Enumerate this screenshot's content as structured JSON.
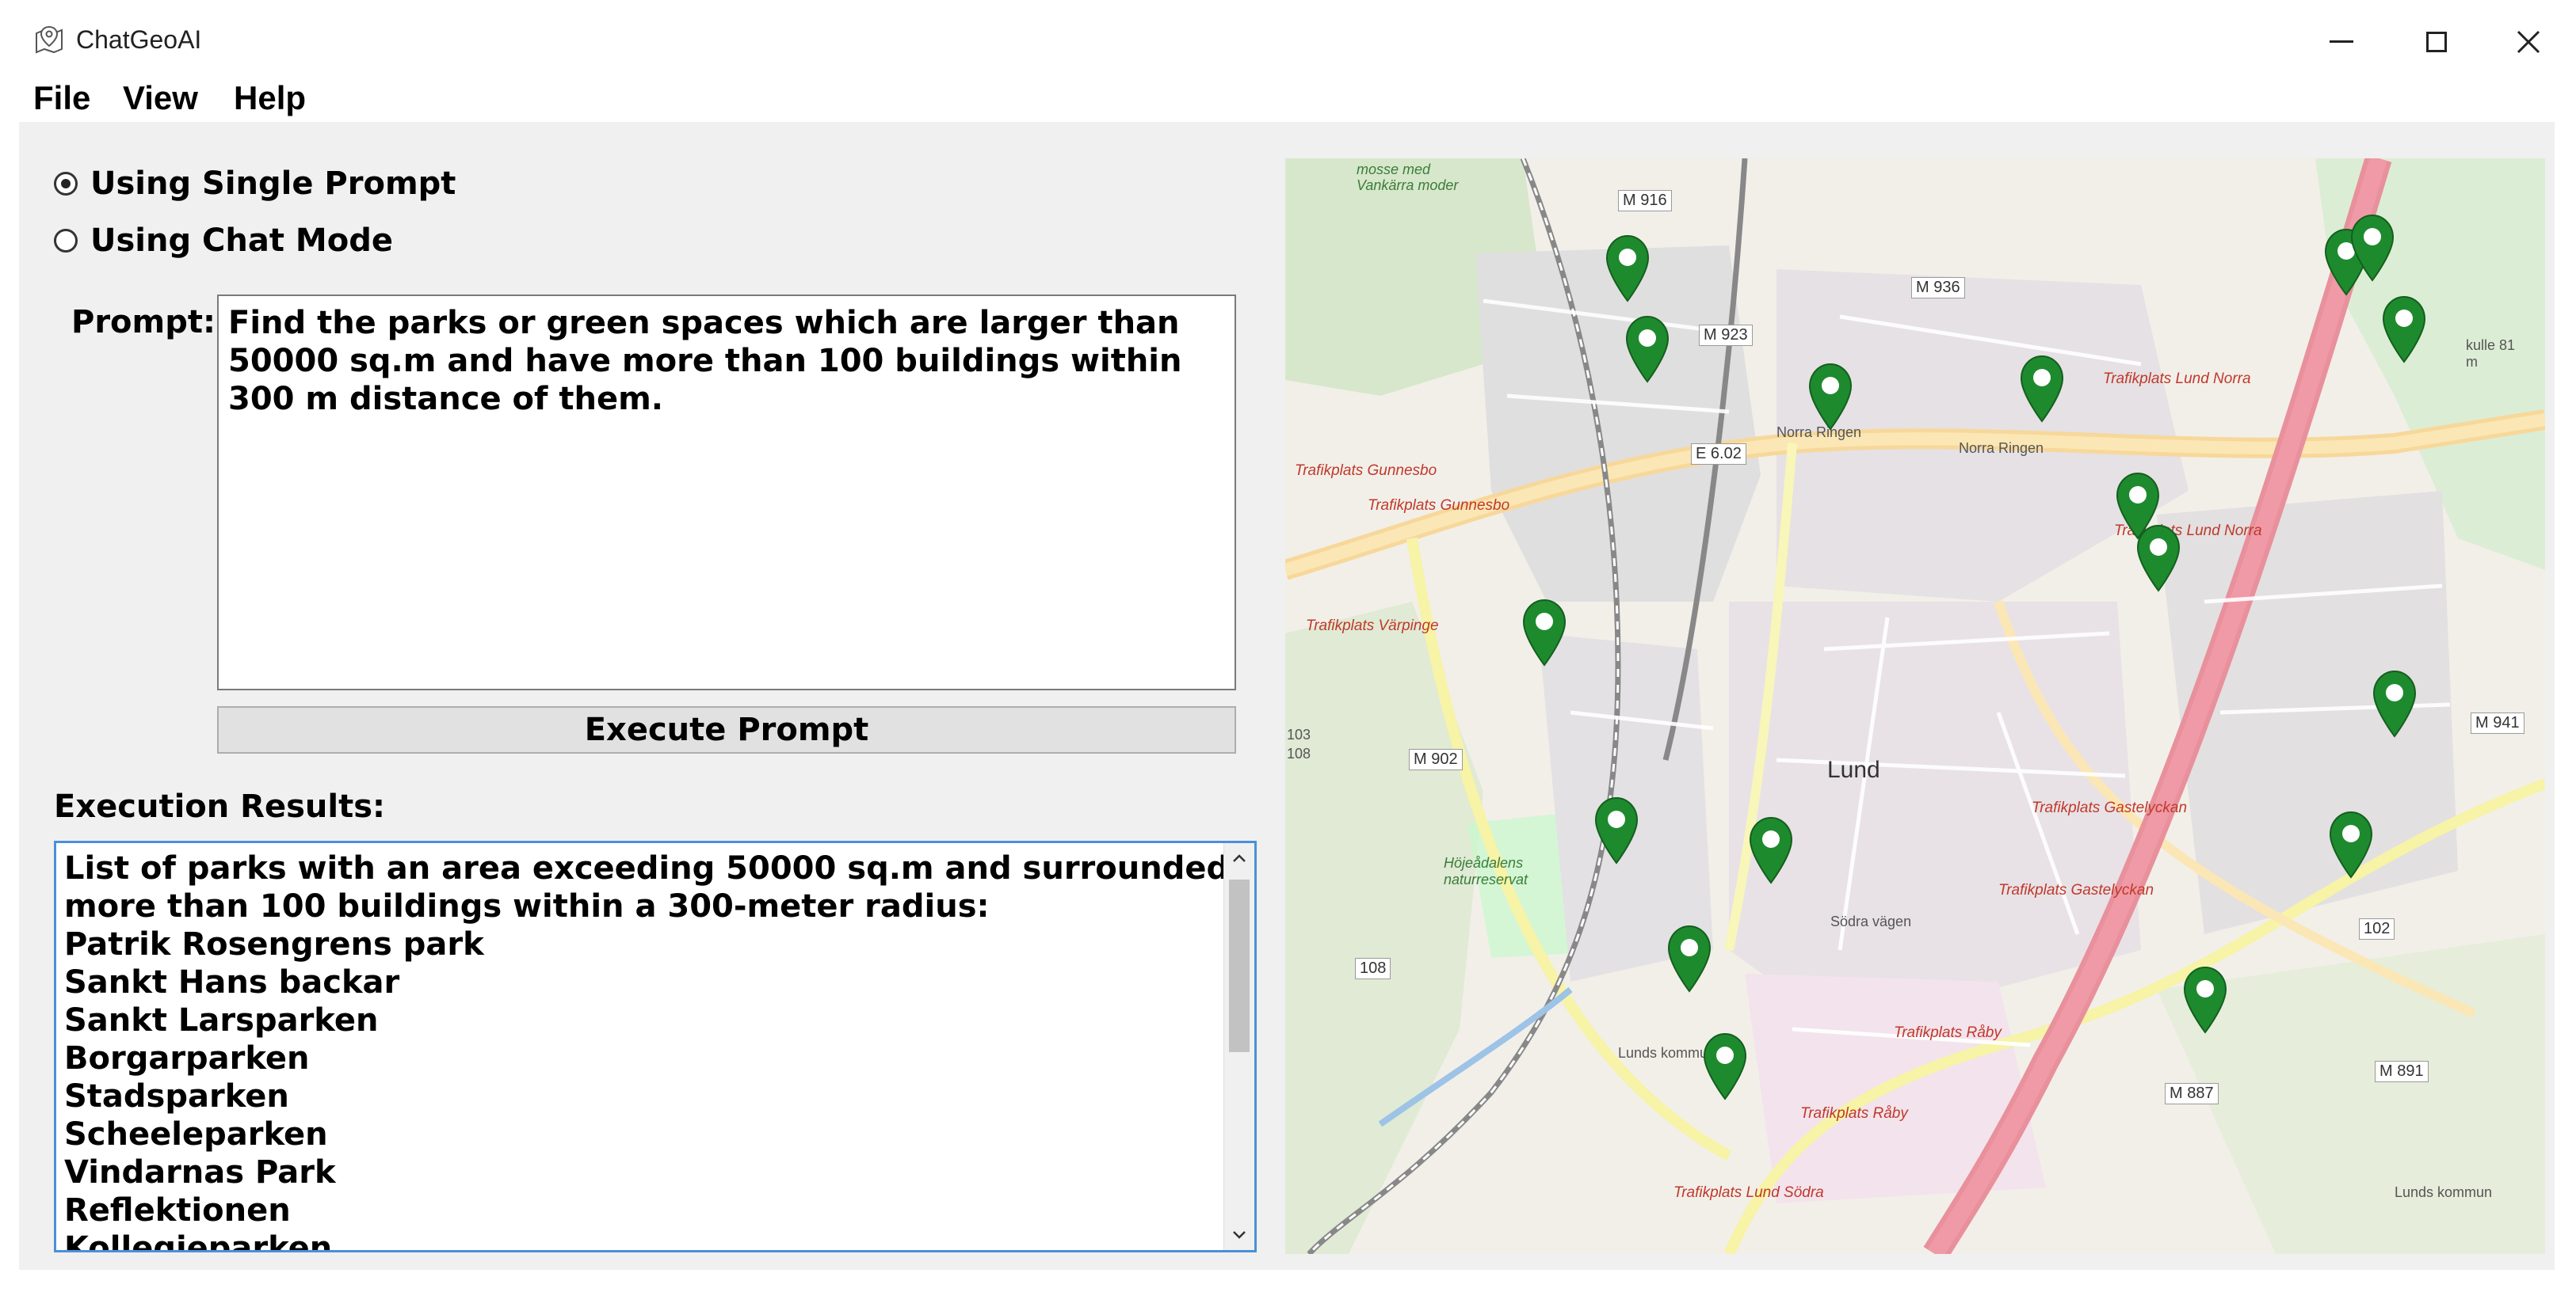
{
  "window": {
    "title": "ChatGeoAI",
    "app_icon": "map-pin-icon",
    "controls": [
      "minimize-icon",
      "maximize-icon",
      "close-icon"
    ]
  },
  "menu": {
    "file": "File",
    "view": "View",
    "help": "Help"
  },
  "mode": {
    "single_prompt_label": "Using Single Prompt",
    "chat_mode_label": "Using Chat Mode",
    "selected": "single"
  },
  "prompt": {
    "label": "Prompt:",
    "text": "Find the parks or green spaces which are larger than 50000 sq.m and have more than 100 buildings within 300 m distance of them."
  },
  "execute_button": "Execute Prompt",
  "results": {
    "label": "Execution Results:",
    "header_line1": "List of parks with an area exceeding 50000 sq.m and surrounded by",
    "header_line2": "more than 100 buildings within a 300-meter radius:",
    "parks": [
      "Patrik Rosengrens park",
      "Sankt Hans backar",
      "Sankt Larsparken",
      "Borgarparken",
      "Stadsparken",
      "Scheeleparken",
      "Vindarnas Park",
      "Reflektionen",
      "Kollegieparken"
    ]
  },
  "map": {
    "city_label": "Lund",
    "road_labels": [
      "M 916",
      "M 936",
      "M 923",
      "E 6.02",
      "M 902",
      "M 941",
      "102",
      "108",
      "M 891",
      "M 887",
      "103",
      "108"
    ],
    "place_labels": [
      "Trafikplats Gunnesbo",
      "Trafikplats Gunnesbo",
      "Trafikplats Värpinge",
      "Trafikplats Lund Norra",
      "Trafikplats Lund Norra",
      "Trafikplats Gastelyckan",
      "Trafikplats Gastelyckan",
      "Trafikplats Råby",
      "Trafikplats Råby",
      "Trafikplats Lund Södra",
      "Norra Ringen",
      "Norra Ringen",
      "Södra vägen",
      "Höjeådalens naturreservat",
      "Lunds kommun",
      "Lunds kommun",
      "kulle 81 m",
      "mosse med Vankärra moder"
    ],
    "marker_icon": "map-marker-icon",
    "marker_color": "#1e8a2e",
    "marker_count": 18
  }
}
